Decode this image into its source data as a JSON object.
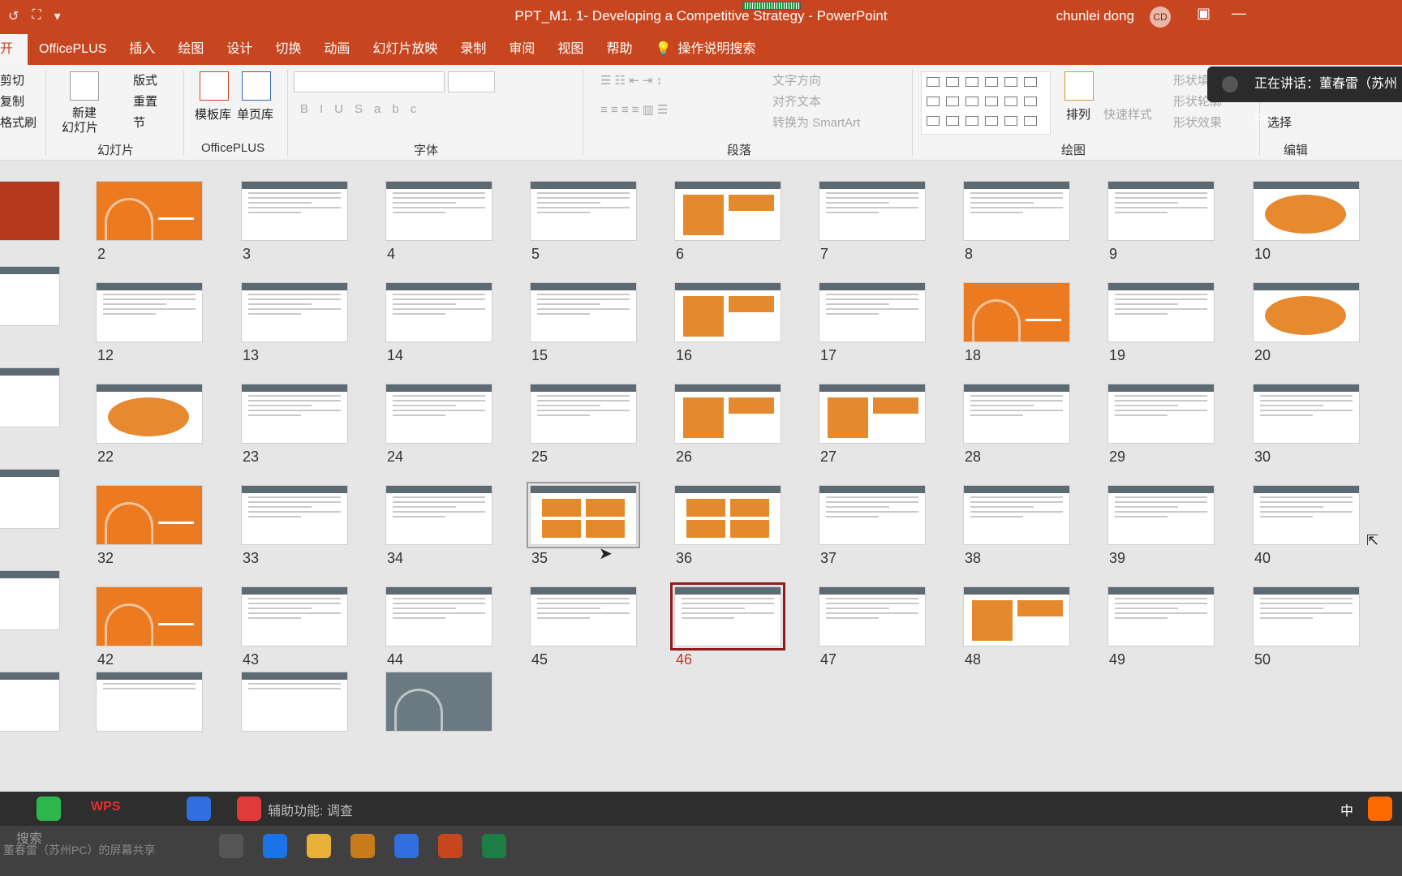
{
  "titlebar": {
    "doc_title": "PPT_M1. 1- Developing a Competitive Strategy  -  PowerPoint",
    "user_name": "chunlei dong",
    "avatar_initials": "CD"
  },
  "tabs": [
    "开始",
    "OfficePLUS",
    "插入",
    "绘图",
    "设计",
    "切换",
    "动画",
    "幻灯片放映",
    "录制",
    "审阅",
    "视图",
    "帮助"
  ],
  "tell_me": "操作说明搜索",
  "ribbon": {
    "clipboard": {
      "cut": "剪切",
      "copy": "复制",
      "format_painter": "格式刷"
    },
    "slides_group": {
      "new_slide": "新建",
      "new_slide2": "幻灯片",
      "layout": "版式",
      "reset": "重置",
      "section": "节",
      "label": "幻灯片"
    },
    "officeplus_group": {
      "template": "模板库",
      "single": "单页库",
      "label": "OfficePLUS"
    },
    "font_group": {
      "label": "字体"
    },
    "paragraph_group": {
      "text_direction": "文字方向",
      "align_text": "对齐文本",
      "smartart": "转换为 SmartArt",
      "label": "段落"
    },
    "drawing_group": {
      "arrange": "排列",
      "quick_styles": "快速样式",
      "shape_fill": "形状填",
      "shape_outline": "形状轮廓",
      "shape_effects": "形状效果",
      "label": "绘图"
    },
    "editing_group": {
      "select": "选择",
      "label": "编辑"
    }
  },
  "speaking_toast": "正在讲话：董春雷（苏州PC",
  "slides": [
    {
      "n": "2",
      "style": "orange"
    },
    {
      "n": "3"
    },
    {
      "n": "4"
    },
    {
      "n": "5"
    },
    {
      "n": "6"
    },
    {
      "n": "7"
    },
    {
      "n": "8"
    },
    {
      "n": "9"
    },
    {
      "n": "10"
    },
    {
      "n": "12"
    },
    {
      "n": "13"
    },
    {
      "n": "14"
    },
    {
      "n": "15"
    },
    {
      "n": "16"
    },
    {
      "n": "17"
    },
    {
      "n": "18",
      "style": "orange"
    },
    {
      "n": "19"
    },
    {
      "n": "20"
    },
    {
      "n": "22"
    },
    {
      "n": "23"
    },
    {
      "n": "24"
    },
    {
      "n": "25"
    },
    {
      "n": "26"
    },
    {
      "n": "27"
    },
    {
      "n": "28"
    },
    {
      "n": "29"
    },
    {
      "n": "30"
    },
    {
      "n": "32",
      "style": "orange"
    },
    {
      "n": "33"
    },
    {
      "n": "34"
    },
    {
      "n": "35"
    },
    {
      "n": "36"
    },
    {
      "n": "37"
    },
    {
      "n": "38"
    },
    {
      "n": "39"
    },
    {
      "n": "40"
    },
    {
      "n": "42",
      "style": "orange"
    },
    {
      "n": "43"
    },
    {
      "n": "44"
    },
    {
      "n": "45"
    },
    {
      "n": "46",
      "selected": true
    },
    {
      "n": "47"
    },
    {
      "n": "48"
    },
    {
      "n": "49"
    },
    {
      "n": "50"
    }
  ],
  "taskbar": {
    "wps": "WPS",
    "assist": "辅助功能: 调查",
    "share": "董春雷（苏州PC）的屏幕共享",
    "ime": "中",
    "search_hint": "搜索"
  },
  "colors": {
    "accent": "#c8461f",
    "orange_slide": "#ec7a20",
    "selected": "#8e1b1b"
  }
}
